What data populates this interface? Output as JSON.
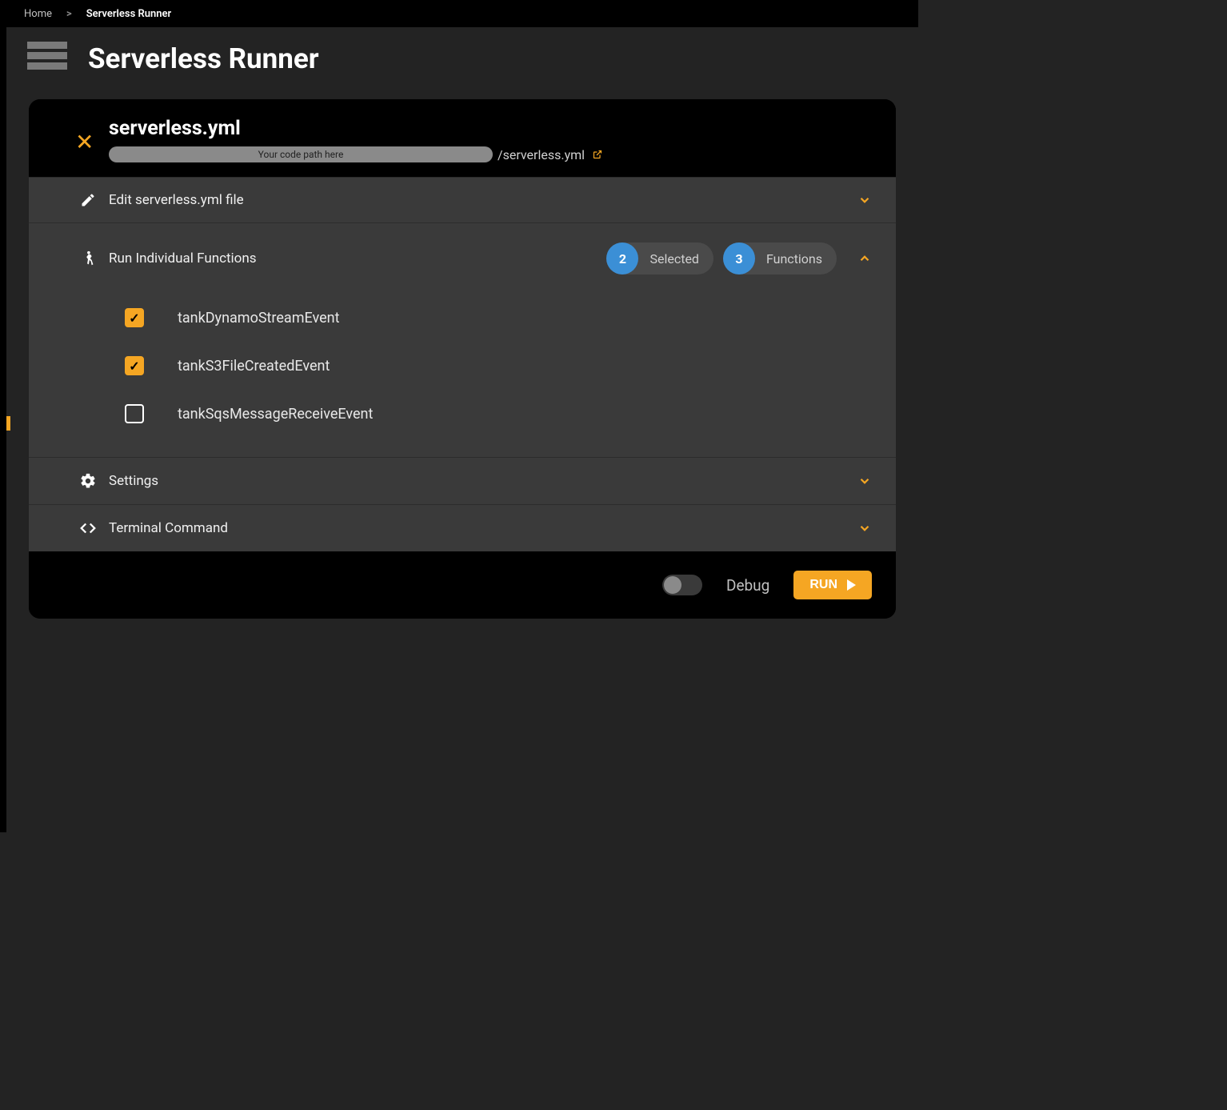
{
  "breadcrumb": {
    "home": "Home",
    "current": "Serverless Runner"
  },
  "page": {
    "title": "Serverless Runner"
  },
  "file": {
    "name": "serverless.yml",
    "path_placeholder": "Your code path here",
    "path_tail": "/serverless.yml"
  },
  "sections": {
    "edit": {
      "label": "Edit serverless.yml file",
      "expanded": false
    },
    "run": {
      "label": "Run Individual Functions",
      "expanded": true,
      "selected_count": "2",
      "selected_label": "Selected",
      "total_count": "3",
      "total_label": "Functions",
      "functions": [
        {
          "name": "tankDynamoStreamEvent",
          "checked": true
        },
        {
          "name": "tankS3FileCreatedEvent",
          "checked": true
        },
        {
          "name": "tankSqsMessageReceiveEvent",
          "checked": false
        }
      ]
    },
    "settings": {
      "label": "Settings",
      "expanded": false
    },
    "terminal": {
      "label": "Terminal Command",
      "expanded": false
    }
  },
  "footer": {
    "debug_label": "Debug",
    "debug_on": false,
    "run_label": "RUN"
  }
}
